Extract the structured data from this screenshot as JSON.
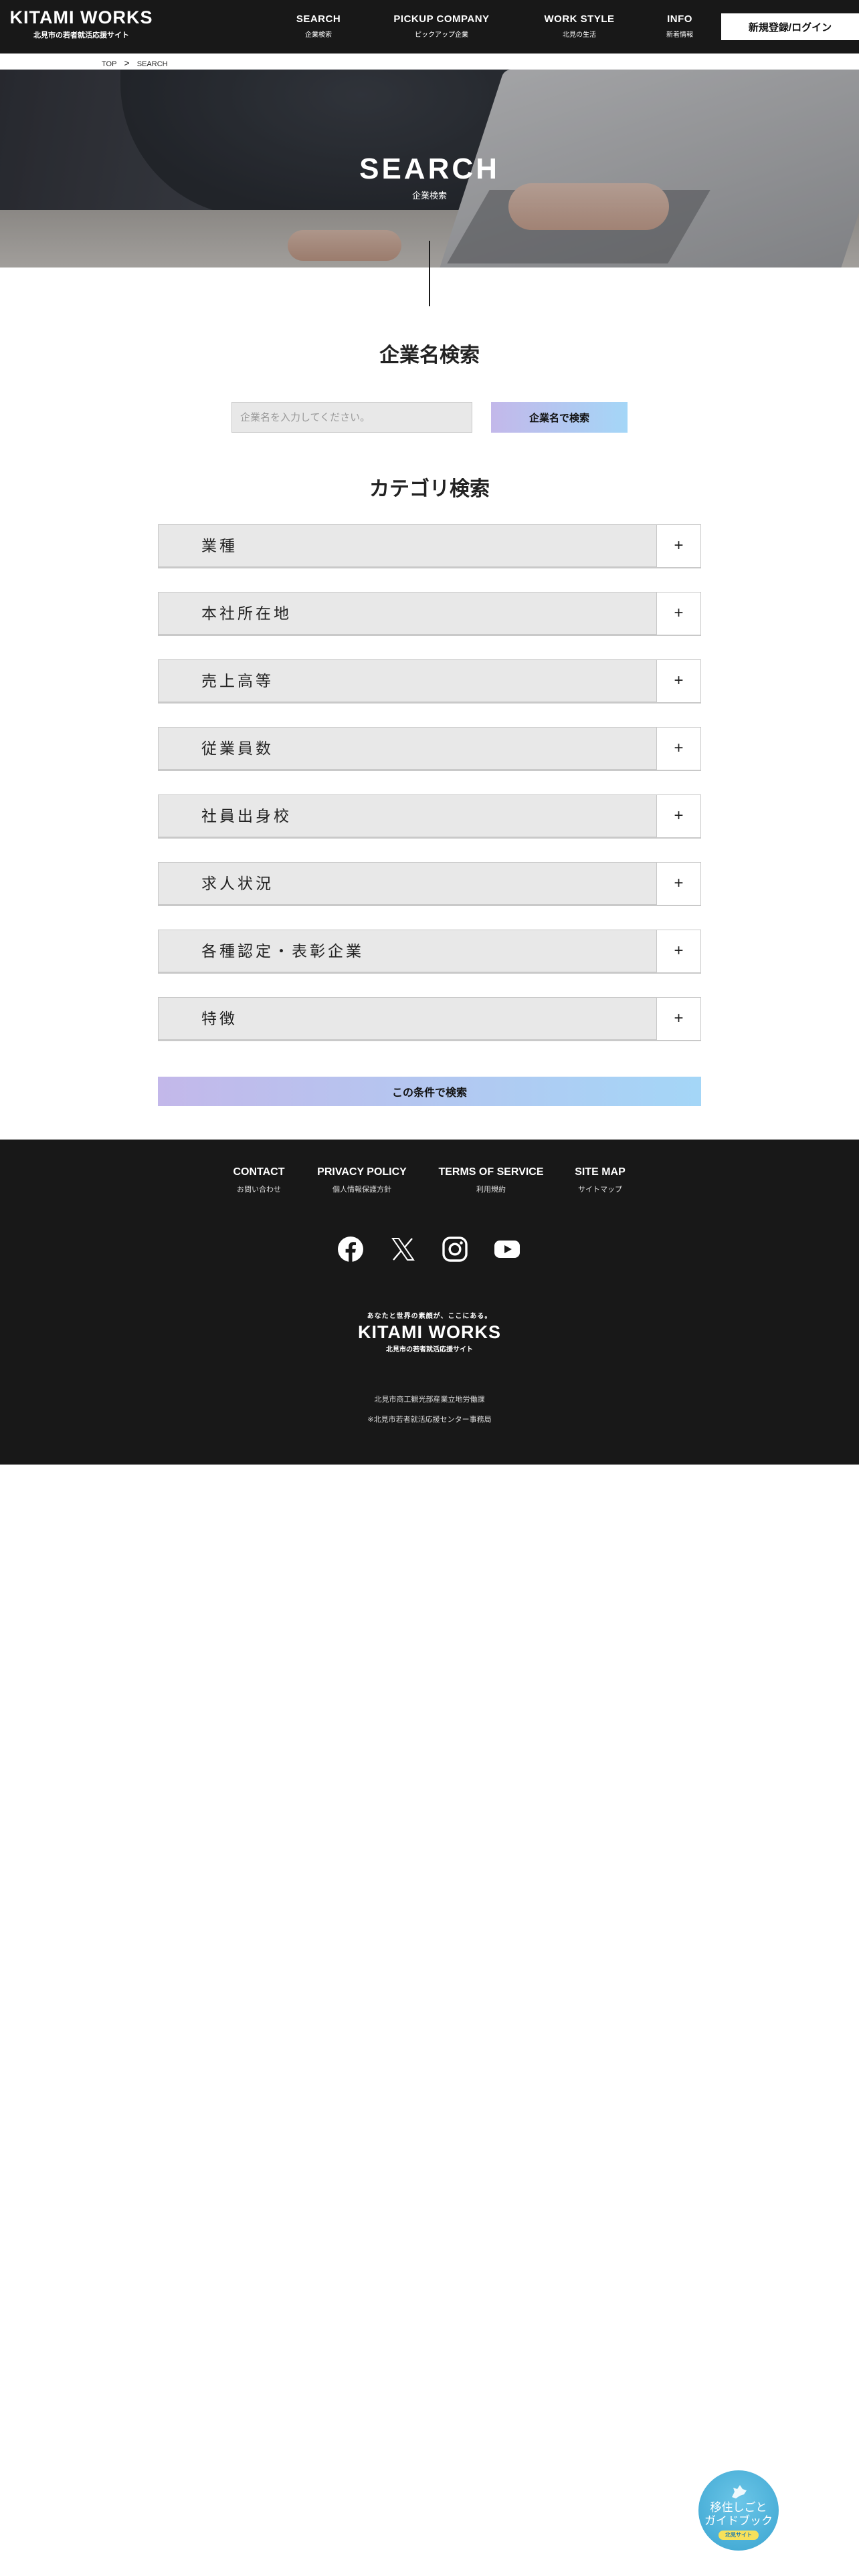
{
  "header": {
    "logo": "KITAMI WORKS",
    "logo_sub": "北見市の若者就活応援サイト",
    "nav": [
      {
        "en": "SEARCH",
        "ja": "企業検索"
      },
      {
        "en": "PICKUP COMPANY",
        "ja": "ピックアップ企業"
      },
      {
        "en": "WORK STYLE",
        "ja": "北見の生活"
      },
      {
        "en": "INFO",
        "ja": "新着情報"
      }
    ],
    "login_label": "新規登録/ログイン"
  },
  "breadcrumb": {
    "items": [
      "TOP",
      ">",
      "SEARCH"
    ]
  },
  "hero": {
    "title": "SEARCH",
    "subtitle": "企業検索"
  },
  "name_search": {
    "title": "企業名検索",
    "placeholder": "企業名を入力してください。",
    "button": "企業名で検索"
  },
  "category_search": {
    "title": "カテゴリ検索",
    "categories": [
      "業種",
      "本社所在地",
      "売上高等",
      "従業員数",
      "社員出身校",
      "求人状況",
      "各種認定・表彰企業",
      "特徴"
    ],
    "expand_symbol": "+",
    "submit": "この条件で検索"
  },
  "footer": {
    "nav": [
      {
        "en": "CONTACT",
        "ja": "お問い合わせ"
      },
      {
        "en": "PRIVACY POLICY",
        "ja": "個人情報保護方針"
      },
      {
        "en": "TERMS OF SERVICE",
        "ja": "利用規約"
      },
      {
        "en": "SITE MAP",
        "ja": "サイトマップ"
      }
    ],
    "social": [
      "facebook-icon",
      "x-icon",
      "instagram-icon",
      "youtube-icon"
    ],
    "logo_tag": "あなたと世界の素顔が、ここにある。",
    "logo": "KITAMI WORKS",
    "logo_sub": "北見市の若者就活応援サイト",
    "note1": "北見市商工観光部産業立地労働課",
    "note2": "※北見市若者就活応援センター事務局"
  },
  "badge": {
    "line1": "移住しごと",
    "line2": "ガイドブック",
    "tag": "北見サイト"
  },
  "colors": {
    "header_bg": "#181818",
    "accent_start": "#c3b8ea",
    "accent_end": "#a4d6f7",
    "category_bg": "#e8e8e8"
  }
}
